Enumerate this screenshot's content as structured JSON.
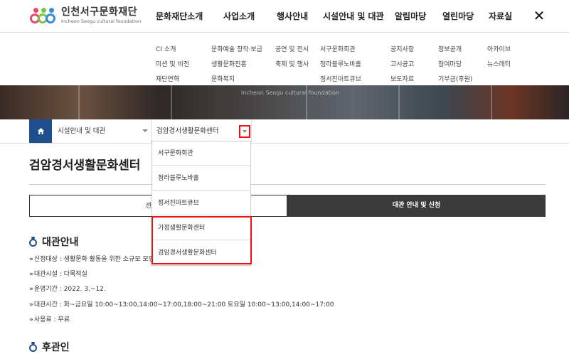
{
  "logo": {
    "title": "인천서구문화재단",
    "subtitle": "Incheon Seogu cultural foundation"
  },
  "gnb": [
    "문화재단소개",
    "사업소개",
    "행사안내",
    "시설안내 및 대관",
    "알림마당",
    "열린마당",
    "자료실"
  ],
  "close_icon": "✕",
  "submenu": {
    "col1": [
      "CI 소개",
      "미션 및 비전",
      "재단연혁"
    ],
    "col2": [
      "문화예술 창작·보급",
      "생활문화진흥",
      "문화복지"
    ],
    "col3": [
      "공연 및 전시",
      "축제 및 행사"
    ],
    "col4": [
      "서구문화회관",
      "청라블루노바홀",
      "정서진아트큐브"
    ],
    "col5": [
      "공지사항",
      "고시공고",
      "보도자료"
    ],
    "col6": [
      "정보공개",
      "참여마당",
      "기부금(후원)"
    ],
    "col7": [
      "아카이브",
      "뉴스레터"
    ]
  },
  "banner_text": "Incheon Seogu cultural foundation",
  "location": {
    "level1": "시설안내 및 대관",
    "level2": "검암경서생활문화센터"
  },
  "dropdown_items": [
    "서구문화회관",
    "청라블루노바홀",
    "정서진아트큐브",
    "가정생활문화센터",
    "검암경서생활문화센터"
  ],
  "page_title": "검암경서생활문화센터",
  "tabs": {
    "left": "센터 소개",
    "right": "대관 안내 및 신청"
  },
  "section1": {
    "title": "대관안내",
    "items": [
      "신청대상 : 생활문화 활동을 위한 소규모 모임",
      "대관시설 : 다목적실",
      "운영기간 : 2022. 3.~12.",
      "대관시간 : 화~금요일 10:00~13:00,14:00~17:00,18:00~21:00 토요일 10:00~13:00,14:00~17:00",
      "사용료 : 무료"
    ]
  },
  "section2": {
    "title": "후관인"
  },
  "colors": {
    "brand_blue": "#1e4e8c",
    "highlight_red": "#ee1111",
    "active_tab": "#3b3b3b"
  }
}
